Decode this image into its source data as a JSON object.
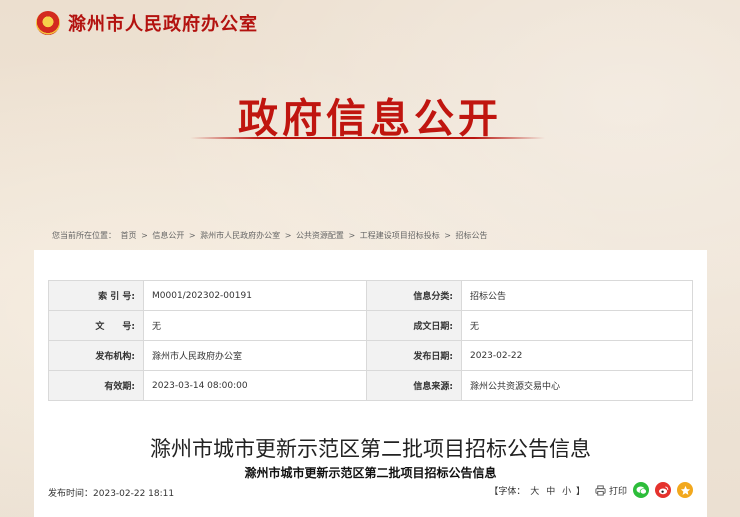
{
  "header": {
    "site_title": "滁州市人民政府办公室"
  },
  "banner": {
    "title": "政府信息公开"
  },
  "breadcrumb": {
    "prefix": "您当前所在位置：",
    "items": [
      "首页",
      "信息公开",
      "滁州市人民政府办公室",
      "公共资源配置",
      "工程建设项目招标投标",
      "招标公告"
    ],
    "separator": " > "
  },
  "meta": {
    "rows": [
      {
        "k1": "索 引 号:",
        "v1": "M0001/202302-00191",
        "k2": "信息分类:",
        "v2": "招标公告"
      },
      {
        "k1": "文　　号:",
        "v1": "无",
        "k2": "成文日期:",
        "v2": "无"
      },
      {
        "k1": "发布机构:",
        "v1": "滁州市人民政府办公室",
        "k2": "发布日期:",
        "v2": "2023-02-22"
      },
      {
        "k1": "有效期:",
        "v1": "2023-03-14 08:00:00",
        "k2": "信息来源:",
        "v2": "滁州公共资源交易中心"
      }
    ]
  },
  "article": {
    "title": "滁州市城市更新示范区第二批项目招标公告信息",
    "subtitle": "滁州市城市更新示范区第二批项目招标公告信息",
    "publish_label": "发布时间：",
    "publish_time": "2023-02-22 18:11"
  },
  "tools": {
    "font_label": "【字体：",
    "font_large": "大",
    "font_medium": "中",
    "font_small": "小",
    "font_close": "】",
    "print_label": "打印"
  },
  "colors": {
    "brand_red": "#c0150f",
    "wechat": "#2dbd3a",
    "weibo": "#e5322d",
    "qzone": "#f2a81d"
  },
  "icons": [
    "emblem-icon",
    "print-icon",
    "wechat-icon",
    "weibo-icon",
    "qzone-icon"
  ]
}
